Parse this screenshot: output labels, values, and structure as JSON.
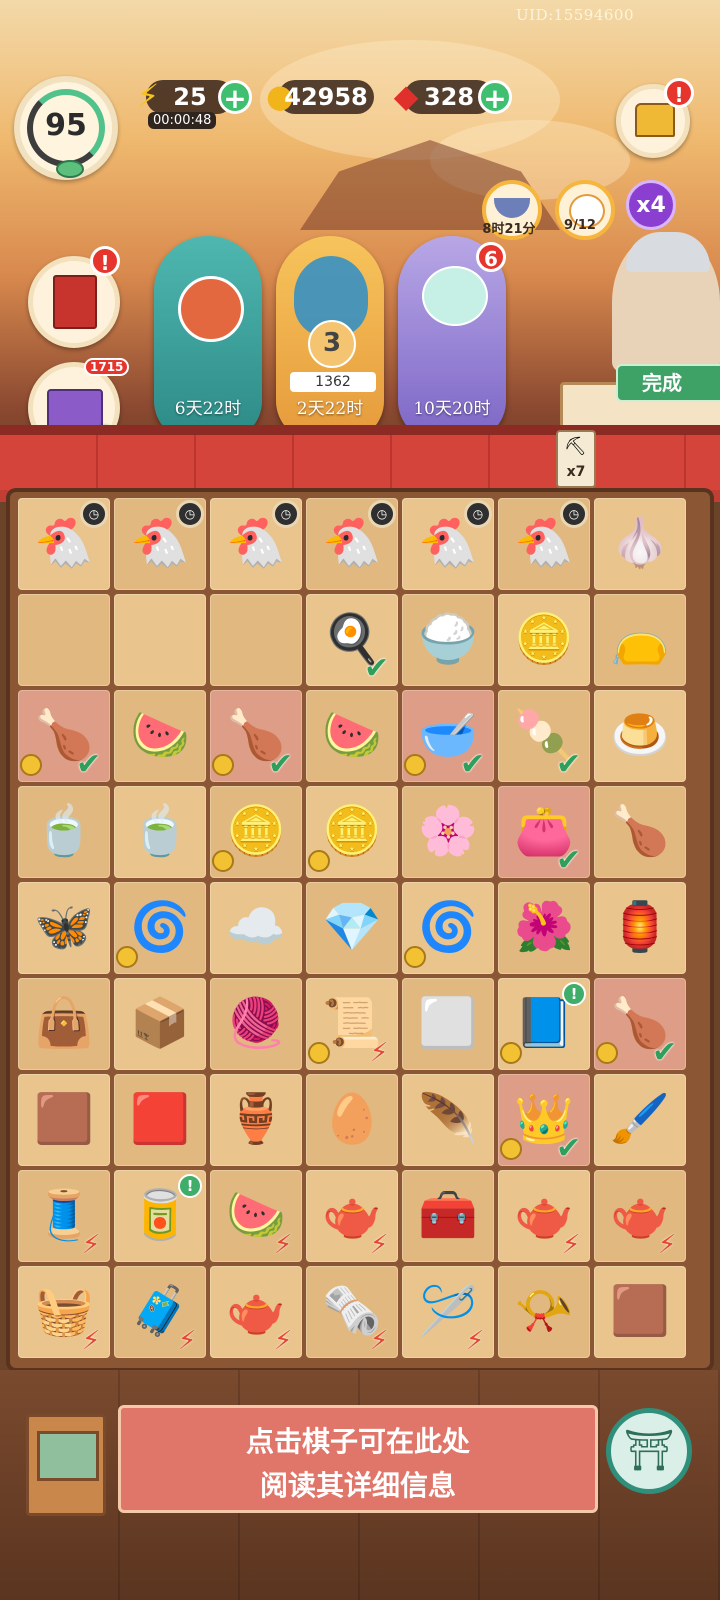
{
  "uid": "UID:15594600",
  "level": "95",
  "resources": {
    "energy": {
      "value": "25",
      "timer": "00:00:48",
      "icon": "lightning-icon"
    },
    "coins": {
      "value": "42958",
      "icon": "gold-coin-icon"
    },
    "gems": {
      "value": "328",
      "icon": "red-gem-icon"
    }
  },
  "left_buttons": {
    "book_alert": "!",
    "giftbox_count": "1715"
  },
  "event_cards": [
    {
      "label": "6天22时",
      "theme": "red-panda"
    },
    {
      "label": "2天22时",
      "count": "3",
      "points": "1362",
      "theme": "peacock"
    },
    {
      "label": "10天20时",
      "badge": "6",
      "theme": "cloud-fox"
    }
  ],
  "mini_events": [
    {
      "label": "8时21分",
      "icon": "bowl-icon"
    },
    {
      "label": "9/12",
      "icon": "cat-icon"
    }
  ],
  "multiplier": "x4",
  "shop_alert": "!",
  "complete_button": "完成",
  "pickaxe_count": "x7",
  "board": {
    "rows": [
      [
        {
          "icon": "🐔",
          "name": "golden-hen-icon",
          "timer": true
        },
        {
          "icon": "🐔",
          "name": "golden-hen-icon",
          "timer": true
        },
        {
          "icon": "🐔",
          "name": "golden-hen-icon",
          "timer": true
        },
        {
          "icon": "🐔",
          "name": "golden-hen-icon",
          "timer": true
        },
        {
          "icon": "🐔",
          "name": "golden-hen-icon",
          "timer": true
        },
        {
          "icon": "🐔",
          "name": "golden-hen-icon",
          "timer": true
        },
        {
          "icon": "🧄",
          "name": "cotton-bowl-icon"
        }
      ],
      [
        {
          "icon": "",
          "name": "empty"
        },
        {
          "icon": "",
          "name": "empty"
        },
        {
          "icon": "",
          "name": "empty"
        },
        {
          "icon": "🍳",
          "name": "egg-dish-icon",
          "check": true
        },
        {
          "icon": "🍚",
          "name": "fried-rice-icon"
        },
        {
          "icon": "🪙",
          "name": "copper-coins-icon"
        },
        {
          "icon": "👝",
          "name": "silk-pouch-icon"
        }
      ],
      [
        {
          "icon": "🍗",
          "name": "roast-chicken-platter-icon",
          "check": true,
          "coin": true,
          "hl": true
        },
        {
          "icon": "🍉",
          "name": "watermelon-tray-icon"
        },
        {
          "icon": "🍗",
          "name": "roast-chicken-platter-icon",
          "check": true,
          "coin": true,
          "hl": true
        },
        {
          "icon": "🍉",
          "name": "fruit-tray-icon"
        },
        {
          "icon": "🥣",
          "name": "soup-bowl-icon",
          "check": true,
          "coin": true,
          "hl": true
        },
        {
          "icon": "🍡",
          "name": "rice-cake-icon",
          "check": true
        },
        {
          "icon": "🍮",
          "name": "custard-bowl-icon"
        }
      ],
      [
        {
          "icon": "🍵",
          "name": "tea-bowl-icon"
        },
        {
          "icon": "🍵",
          "name": "tea-cup-icon"
        },
        {
          "icon": "🪙",
          "name": "coin-stack-icon",
          "coin": true
        },
        {
          "icon": "🪙",
          "name": "coin-stack-icon",
          "coin": true
        },
        {
          "icon": "🌸",
          "name": "flower-cake-icon"
        },
        {
          "icon": "👛",
          "name": "embroidered-purse-icon",
          "check": true,
          "hl": true
        },
        {
          "icon": "🍗",
          "name": "roast-chicken-icon"
        }
      ],
      [
        {
          "icon": "🦋",
          "name": "butterfly-hairpin-icon"
        },
        {
          "icon": "🌀",
          "name": "jade-cloud-icon",
          "coin": true
        },
        {
          "icon": "☁️",
          "name": "cloud-ornament-icon"
        },
        {
          "icon": "💎",
          "name": "earrings-icon"
        },
        {
          "icon": "🌀",
          "name": "jade-cloud-icon",
          "coin": true
        },
        {
          "icon": "🌺",
          "name": "flower-pastry-icon"
        },
        {
          "icon": "🏮",
          "name": "lantern-icon"
        }
      ],
      [
        {
          "icon": "👜",
          "name": "purple-bag-icon"
        },
        {
          "icon": "📦",
          "name": "tea-crate-icon"
        },
        {
          "icon": "🧶",
          "name": "spindle-icon"
        },
        {
          "icon": "📜",
          "name": "scroll-box-icon",
          "coin": true,
          "bolt": true
        },
        {
          "icon": "⬜",
          "name": "small-tray-icon"
        },
        {
          "icon": "📘",
          "name": "book-stack-icon",
          "coin": true,
          "excl": true
        },
        {
          "icon": "🍗",
          "name": "roast-chicken-platter-icon",
          "check": true,
          "coin": true,
          "hl": true
        }
      ],
      [
        {
          "icon": "🟫",
          "name": "wooden-box-icon"
        },
        {
          "icon": "🟥",
          "name": "red-gem-icon"
        },
        {
          "icon": "🏺",
          "name": "energy-jar-icon"
        },
        {
          "icon": "🥚",
          "name": "egg-nest-icon"
        },
        {
          "icon": "🪶",
          "name": "silk-bundle-icon"
        },
        {
          "icon": "👑",
          "name": "golden-crown-icon",
          "check": true,
          "coin": true,
          "hl": true
        },
        {
          "icon": "🖌️",
          "name": "brush-ruler-icon"
        }
      ],
      [
        {
          "icon": "🧵",
          "name": "spinning-wheel-icon",
          "bolt": true
        },
        {
          "icon": "🥫",
          "name": "red-tin-icon",
          "excl": true
        },
        {
          "icon": "🍉",
          "name": "food-crate-icon",
          "bolt": true
        },
        {
          "icon": "🫖",
          "name": "teapot-icon",
          "bolt": true
        },
        {
          "icon": "🧰",
          "name": "treasure-chest-icon"
        },
        {
          "icon": "🫖",
          "name": "tea-set-icon",
          "bolt": true
        },
        {
          "icon": "🫖",
          "name": "tea-set-icon",
          "bolt": true
        }
      ],
      [
        {
          "icon": "🧺",
          "name": "fruit-basket-icon",
          "bolt": true
        },
        {
          "icon": "🧳",
          "name": "jewelry-chest-icon",
          "bolt": true
        },
        {
          "icon": "🫖",
          "name": "teapot-cup-icon",
          "bolt": true
        },
        {
          "icon": "🗞️",
          "name": "scroll-crate-icon",
          "bolt": true
        },
        {
          "icon": "🪡",
          "name": "loom-icon",
          "bolt": true
        },
        {
          "icon": "📯",
          "name": "horn-brush-icon"
        },
        {
          "icon": "🟫",
          "name": "wooden-box-icon"
        }
      ]
    ]
  },
  "info_panel": {
    "line1": "点击棋子可在此处",
    "line2": "阅读其详细信息"
  }
}
